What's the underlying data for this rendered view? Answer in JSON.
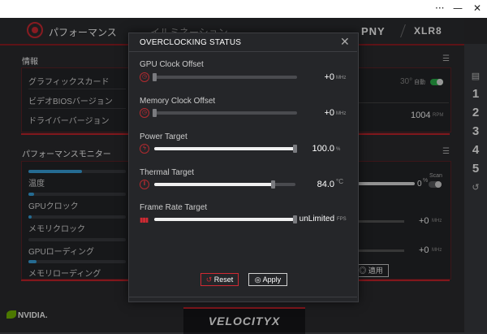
{
  "window": {
    "menu_glyph": "···",
    "minimize_glyph": "—",
    "close_glyph": "✕"
  },
  "header": {
    "tab_performance": "パフォーマンス",
    "tab_illumination": "イルミネーション",
    "brand_pny": "PNY",
    "brand_xlr8": "XLR8"
  },
  "info_section": {
    "title": "情報",
    "rows": [
      {
        "label": "グラフィックスカード"
      },
      {
        "label": "ビデオBIOSバージョン"
      },
      {
        "label": "ドライバーバージョン"
      }
    ],
    "fan_temp": "30°",
    "fan_mode": "自動",
    "fan_rpm": "1004",
    "fan_rpm_unit": "RPM"
  },
  "monitor_section": {
    "title": "パフォーマンスモニター",
    "rows": [
      {
        "label": "温度",
        "progress": 0.55
      },
      {
        "label": "GPUクロック",
        "progress": 0.06
      },
      {
        "label": "メモリクロック",
        "progress": 0.03
      },
      {
        "label": "GPUローディング",
        "progress": 0.0
      },
      {
        "label": "メモリローディング",
        "progress": 0.08
      }
    ],
    "scan_label": "Scan",
    "fan_percent": "0",
    "fan_percent_unit": "%",
    "right_values": [
      {
        "value": "+0",
        "unit": "MHz"
      },
      {
        "value": "+0",
        "unit": "MHz"
      }
    ],
    "apply_label": "適用"
  },
  "sidebar": {
    "profiles": [
      "1",
      "2",
      "3",
      "4",
      "5"
    ]
  },
  "footer": {
    "nvidia": "NVIDIA.",
    "velocity": "VELOCITYX"
  },
  "dialog": {
    "title": "OVERCLOCKING STATUS",
    "close_glyph": "✕",
    "settings": [
      {
        "label": "GPU Clock Offset",
        "value": "+0",
        "unit": "MHz",
        "level": 0.0
      },
      {
        "label": "Memory Clock Offset",
        "value": "+0",
        "unit": "MHz",
        "level": 0.0
      },
      {
        "label": "Power Target",
        "value": "100.0",
        "unit": "%",
        "level": 1.0
      },
      {
        "label": "Thermal Target",
        "value": "84.0",
        "unit": "°C",
        "level": 0.85
      },
      {
        "label": "Frame Rate Target",
        "value": "unLimited",
        "unit": "FPS",
        "level": 1.0
      }
    ],
    "reset_label": "Reset",
    "apply_label": "Apply"
  },
  "colors": {
    "accent_red": "#c8242c",
    "progress_blue": "#39a5e0",
    "toggle_green": "#2ab34a"
  }
}
